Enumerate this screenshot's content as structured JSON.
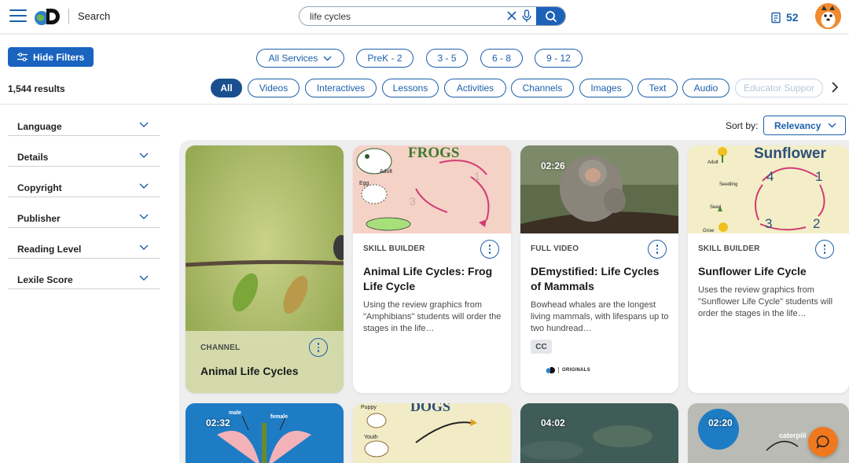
{
  "header": {
    "brand": "Search",
    "search_value": "life cycles",
    "assignments_count": "52"
  },
  "filters_bar": {
    "hide_filters_label": "Hide Filters",
    "services_label": "All Services",
    "grades": [
      "PreK - 2",
      "3 - 5",
      "6 - 8",
      "9 - 12"
    ]
  },
  "results_count": "1,544 results",
  "content_tabs": [
    "All",
    "Videos",
    "Interactives",
    "Lessons",
    "Activities",
    "Channels",
    "Images",
    "Text",
    "Audio",
    "Educator Suppor"
  ],
  "sidebar_filters": [
    "Language",
    "Details",
    "Copyright",
    "Publisher",
    "Reading Level",
    "Lexile Score"
  ],
  "sort": {
    "label": "Sort by:",
    "value": "Relevancy"
  },
  "cards": [
    {
      "type": "CHANNEL",
      "title": "Animal Life Cycles"
    },
    {
      "type": "SKILL BUILDER",
      "title": "Animal Life Cycles: Frog Life Cycle",
      "description": "Using the review graphics from \"Amphibians\" students will order the stages in the life…",
      "thumb_heading": "FROGS",
      "thumb_labels": [
        "Adult",
        "Egg"
      ]
    },
    {
      "type": "FULL VIDEO",
      "title": "DEmystified: Life Cycles of Mammals",
      "description": "Bowhead whales are the longest living mammals, with lifespans up to two hundread…",
      "duration": "02:26",
      "badge": "CC",
      "originals": "ORIGINALS"
    },
    {
      "type": "SKILL BUILDER",
      "title": "Sunflower Life Cycle",
      "description": "Uses the review graphics from \"Sunflower Life Cycle\" students will order the stages in the life…",
      "thumb_heading": "Sunflower",
      "thumb_labels": [
        "Adult",
        "Seedling",
        "Seed",
        "Grow"
      ],
      "thumb_numbers": [
        "4",
        "1",
        "3",
        "2"
      ]
    }
  ],
  "row2": [
    {
      "duration": "02:32",
      "labels": [
        "male",
        "female"
      ]
    },
    {
      "heading": "DOGS",
      "labels": [
        "Puppy",
        "Youth"
      ]
    },
    {
      "duration": "04:02"
    },
    {
      "duration": "02:20",
      "labels": [
        "caterpill"
      ]
    }
  ],
  "colors": {
    "primary": "#1c5fab",
    "accent": "#f0781e"
  }
}
